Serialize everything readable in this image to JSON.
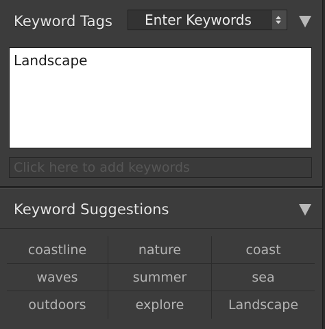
{
  "keyword_tags": {
    "title": "Keyword Tags",
    "mode_select": "Enter Keywords",
    "keywords_text": "Landscape",
    "add_placeholder": "Click here to add keywords"
  },
  "keyword_suggestions": {
    "title": "Keyword Suggestions",
    "suggestions": [
      [
        "coastline",
        "nature",
        "coast"
      ],
      [
        "waves",
        "summer",
        "sea"
      ],
      [
        "outdoors",
        "explore",
        "Landscape"
      ]
    ]
  },
  "icons": {
    "disclosure": "disclosure-triangle-icon",
    "select_arrows": "updown-arrows-icon"
  },
  "colors": {
    "panel_bg": "#3c3c3c",
    "text_light": "#e6e6e6",
    "suggestion_text": "#b4b4b4",
    "textarea_bg": "#ffffff"
  }
}
